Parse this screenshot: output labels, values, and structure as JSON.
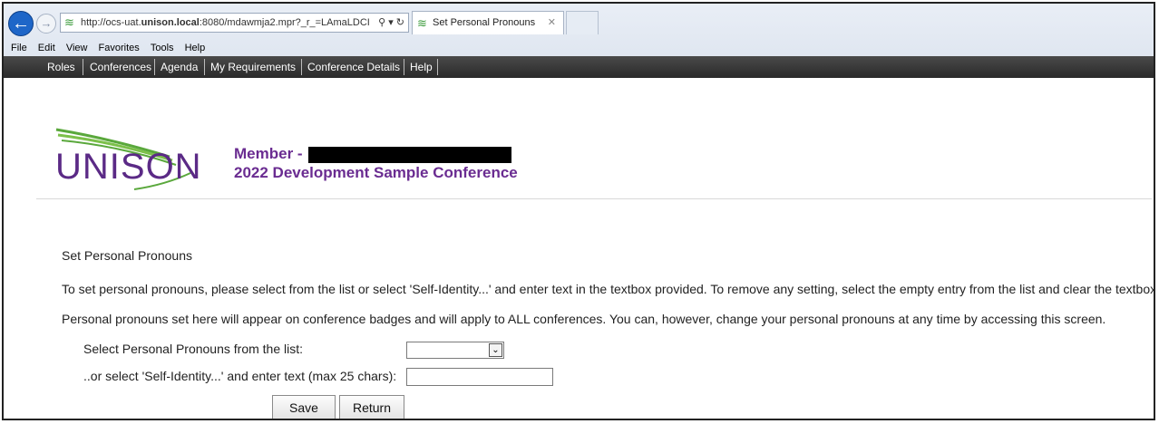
{
  "browser": {
    "url_prefix": "http://ocs-uat.",
    "url_domain": "unison.local",
    "url_suffix": ":8080/mdawmja2.mpr?_r_=LAmaLDCI",
    "url_tools": "⚲ ▾ ↻",
    "tab_title": "Set Personal Pronouns",
    "menu": [
      "File",
      "Edit",
      "View",
      "Favorites",
      "Tools",
      "Help"
    ]
  },
  "sitenav": {
    "items": [
      "Roles",
      "Conferences",
      "Agenda",
      "My Requirements",
      "Conference Details",
      "Help"
    ]
  },
  "header": {
    "logo_text": "UNISON",
    "member_label": "Member -",
    "conference_title": "2022 Development Sample Conference",
    "brand_color": "#6a2c91"
  },
  "content": {
    "heading": "Set Personal Pronouns",
    "instructions_1": "To set personal pronouns, please select from the list or select 'Self-Identity...' and enter text in the textbox provided. To remove any setting, select the empty entry from the list and clear the textbox.",
    "instructions_2": "Personal pronouns set here will appear on conference badges and will apply to ALL conferences. You can, however, change your personal pronouns at any time by accessing this screen.",
    "select_label": "Select Personal Pronouns from the list:",
    "select_value": "",
    "self_label": "..or select 'Self-Identity...' and enter text (max 25 chars):",
    "self_value": "",
    "save_label": "Save",
    "return_label": "Return"
  }
}
